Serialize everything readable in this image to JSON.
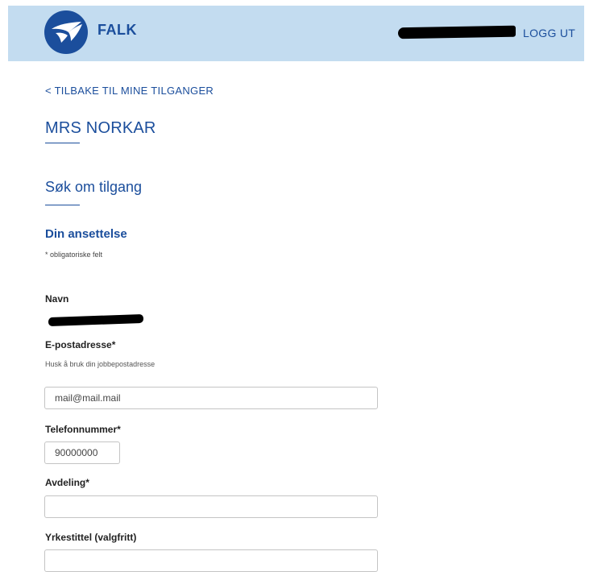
{
  "header": {
    "brand": "FALK",
    "logout_label": "LOGG UT",
    "background_color": "#c3dcf0",
    "accent_color": "#1b4e9c"
  },
  "nav": {
    "back_link": "< TILBAKE TIL MINE TILGANGER"
  },
  "page": {
    "title": "MRS NORKAR",
    "section_title": "Søk om tilgang",
    "subsection_title": "Din ansettelse",
    "required_note": "* obligatoriske felt"
  },
  "form": {
    "name_label": "Navn",
    "email_label": "E-postadresse*",
    "email_hint": "Husk å bruk din jobbepostadresse",
    "email_value": "mail@mail.mail",
    "phone_label": "Telefonnummer*",
    "phone_value": "90000000",
    "department_label": "Avdeling*",
    "department_value": "",
    "job_title_label": "Yrkestittel (valgfritt)",
    "job_title_value": ""
  }
}
